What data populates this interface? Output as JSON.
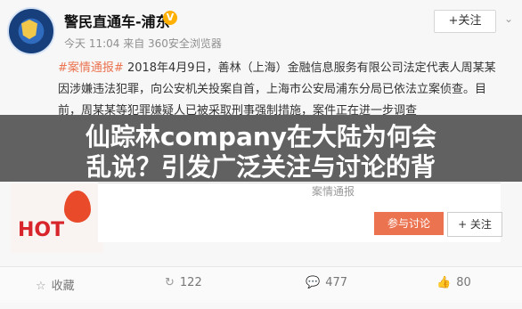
{
  "header": {
    "account_name": "警民直通车-浦东",
    "verified_icon": "V",
    "meta": "今天 11:04 来自 360安全浏览器",
    "follow_label": "+关注",
    "dropdown_icon": "chevron-down-icon"
  },
  "post": {
    "tag": "#案情通报#",
    "text": "2018年4月9日，善林（上海）金融信息服务有限公司法定代表人周某某因涉嫌违法犯罪，向公安机关投案自首，上海市公安局浦东分局已依法立案侦查。目前，周某某等犯罪嫌疑人已被采取刑事强制措施，案件正在进一步调查"
  },
  "banner": {
    "line1": "仙踪林company在大陆为何会",
    "line2": "乱说？引发广泛关注与讨论的背"
  },
  "embedded": {
    "title": "案情通报",
    "hot_label": "HOT",
    "discuss_button": "参与讨论",
    "follow_button": "+ 关注"
  },
  "actions": {
    "collect": "收藏",
    "repost_count": "122",
    "comment_count": "477",
    "like_count": "80"
  }
}
